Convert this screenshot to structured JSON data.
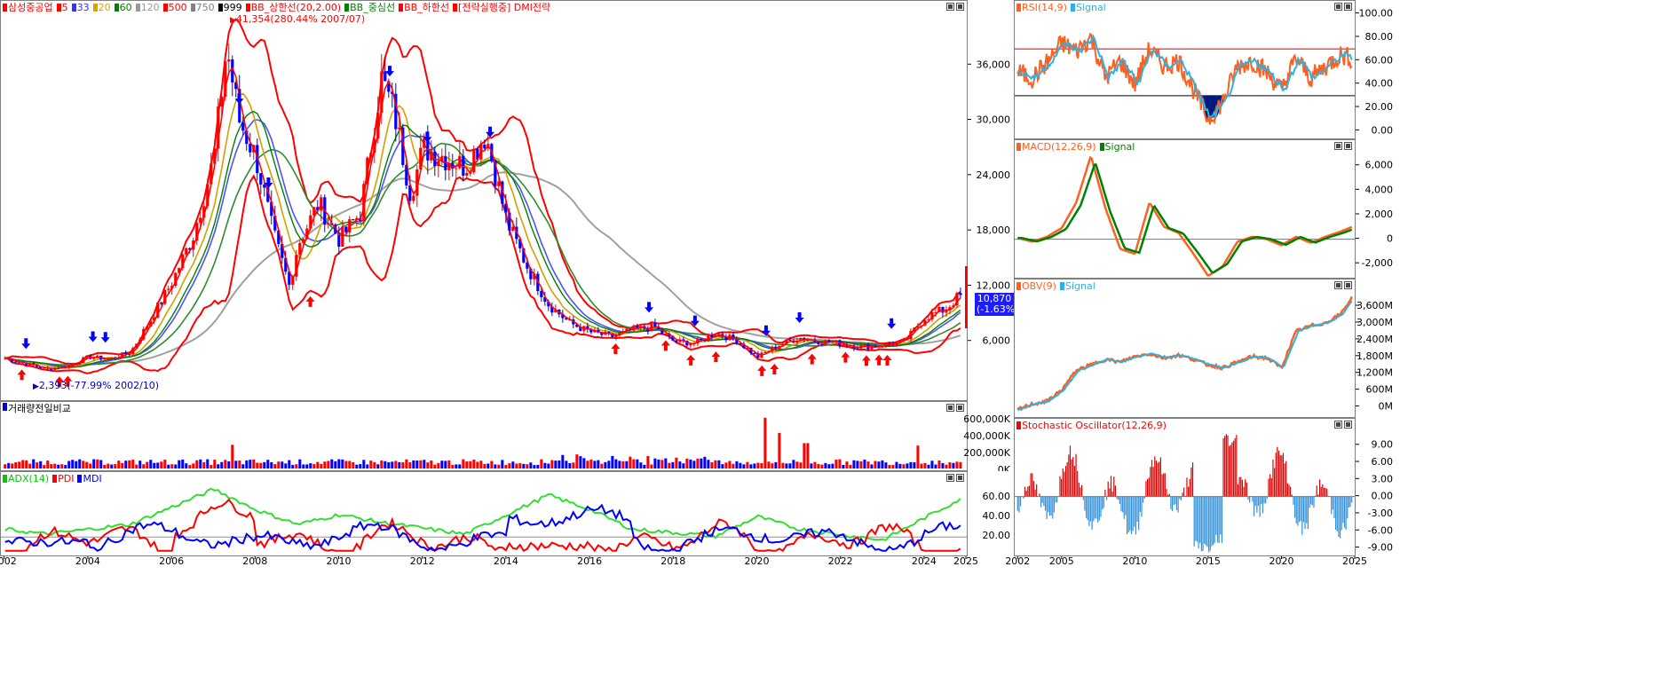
{
  "stock_name": "삼성중공업",
  "main_legend": [
    {
      "label": "삼성중공업",
      "color": "#ff0000"
    },
    {
      "label": "5",
      "color": "#ff0000"
    },
    {
      "label": "33",
      "color": "#3333ff"
    },
    {
      "label": "20",
      "color": "#e0a000"
    },
    {
      "label": "60",
      "color": "#008000"
    },
    {
      "label": "120",
      "color": "#999999"
    },
    {
      "label": "500",
      "color": "#ff0000"
    },
    {
      "label": "750",
      "color": "#808080"
    },
    {
      "label": "999",
      "color": "#000000"
    },
    {
      "label": "BB_상한선(20,2.00)",
      "color": "#ff0000"
    },
    {
      "label": "BB_중심선",
      "color": "#008000"
    },
    {
      "label": "BB_하한선",
      "color": "#ff0000"
    },
    {
      "label": "[전략실행중] DMI전략",
      "color": "#ff0000"
    }
  ],
  "annotations": {
    "high": "41,354(280.44% 2007/07)",
    "low": "2,393(-77.99% 2002/10)"
  },
  "current_price": {
    "value": "10,870",
    "change": "(-1.63%)"
  },
  "volume_legend": "거래량전일비교",
  "adx_legend": [
    {
      "label": "ADX(14)",
      "color": "#00cc00"
    },
    {
      "label": "PDI",
      "color": "#ff0000"
    },
    {
      "label": "MDI",
      "color": "#0000ff"
    }
  ],
  "rsi_legend": [
    {
      "label": "RSI(14,9)",
      "color": "#ff6020"
    },
    {
      "label": "Signal",
      "color": "#30b0e0"
    }
  ],
  "macd_legend": [
    {
      "label": "MACD(12,26,9)",
      "color": "#ff6020"
    },
    {
      "label": "Signal",
      "color": "#008000"
    }
  ],
  "obv_legend": [
    {
      "label": "OBV(9)",
      "color": "#ff6020"
    },
    {
      "label": "Signal",
      "color": "#30b0e0"
    }
  ],
  "stoch_legend": [
    {
      "label": "Stochastic Oscillator(12,26,9)",
      "color": "#ff0000"
    }
  ],
  "chart_data": [
    {
      "type": "candlestick",
      "panel": "price",
      "ylim": [
        0,
        42000
      ],
      "y_ticks": [
        "36,000",
        "30,000",
        "24,000",
        "18,000",
        "12,000",
        "6,000"
      ],
      "y_tick_values": [
        36000,
        30000,
        24000,
        18000,
        12000,
        6000
      ],
      "x": [
        2002,
        2002.5,
        2003,
        2003.5,
        2004,
        2004.5,
        2005,
        2005.5,
        2006,
        2006.5,
        2007,
        2007.3,
        2007.6,
        2008,
        2008.4,
        2008.8,
        2009,
        2009.5,
        2010,
        2010.5,
        2011,
        2011.3,
        2011.7,
        2012,
        2012.5,
        2013,
        2013.5,
        2014,
        2014.5,
        2015,
        2015.5,
        2016,
        2016.5,
        2017,
        2017.5,
        2018,
        2018.5,
        2019,
        2019.5,
        2020,
        2020.5,
        2021,
        2021.5,
        2022,
        2022.5,
        2023,
        2023.5,
        2024,
        2024.5,
        2024.8
      ],
      "close": [
        4200,
        3600,
        3000,
        3300,
        4300,
        4100,
        4800,
        8500,
        12500,
        17500,
        26000,
        38000,
        30000,
        26000,
        18000,
        12000,
        16500,
        21000,
        17000,
        20000,
        34500,
        31000,
        22000,
        27000,
        26000,
        25000,
        28500,
        19000,
        14000,
        10000,
        8000,
        7000,
        6500,
        7200,
        7600,
        6000,
        5800,
        6900,
        6100,
        4300,
        5600,
        6400,
        6000,
        5800,
        5400,
        5600,
        5900,
        8600,
        9500,
        10870
      ]
    },
    {
      "type": "bar",
      "panel": "volume",
      "ylim": [
        0,
        650000
      ],
      "y_ticks": [
        "600,000K",
        "400,000K",
        "200,000K",
        "0K"
      ],
      "y_tick_values": [
        600000,
        400000,
        200000,
        0
      ]
    },
    {
      "type": "line",
      "panel": "adx",
      "ylim": [
        0,
        80
      ],
      "y_ticks": [
        "60.00",
        "40.00",
        "20.00"
      ],
      "y_tick_values": [
        60,
        40,
        20
      ],
      "x_ticks": [
        "2002",
        "2004",
        "2006",
        "2008",
        "2010",
        "2012",
        "2014",
        "2016",
        "2018",
        "2020",
        "2022",
        "2024",
        "2025"
      ],
      "x_tick_values": [
        2002,
        2004,
        2006,
        2008,
        2010,
        2012,
        2014,
        2016,
        2018,
        2020,
        2022,
        2024,
        2025
      ]
    },
    {
      "type": "line",
      "panel": "rsi",
      "ylim": [
        -5,
        105
      ],
      "y_ticks": [
        "100.00",
        "80.00",
        "60.00",
        "40.00",
        "20.00",
        "0.00"
      ],
      "y_tick_values": [
        100,
        80,
        60,
        40,
        20,
        0
      ]
    },
    {
      "type": "line",
      "panel": "macd",
      "ylim": [
        -3000,
        7500
      ],
      "y_ticks": [
        "6,000",
        "4,000",
        "2,000",
        "0",
        "-2,000"
      ],
      "y_tick_values": [
        6000,
        4000,
        2000,
        0,
        -2000
      ]
    },
    {
      "type": "line",
      "panel": "obv",
      "ylim": [
        -300,
        4300
      ],
      "y_ticks": [
        "3,600M",
        "3,000M",
        "2,400M",
        "1,800M",
        "1,200M",
        "600M",
        "0M"
      ],
      "y_tick_values": [
        3600,
        3000,
        2400,
        1800,
        1200,
        600,
        0
      ]
    },
    {
      "type": "bar",
      "panel": "stochastic",
      "ylim": [
        -10,
        13
      ],
      "y_ticks": [
        "9.00",
        "6.00",
        "3.00",
        "0.00",
        "-3.00",
        "-6.00",
        "-9.00"
      ],
      "y_tick_values": [
        9,
        6,
        3,
        0,
        -3,
        -6,
        -9
      ],
      "x_ticks": [
        "2002",
        "2005",
        "2010",
        "2015",
        "2020",
        "2025"
      ],
      "x_tick_values": [
        2002,
        2005,
        2010,
        2015,
        2020,
        2025
      ]
    }
  ]
}
